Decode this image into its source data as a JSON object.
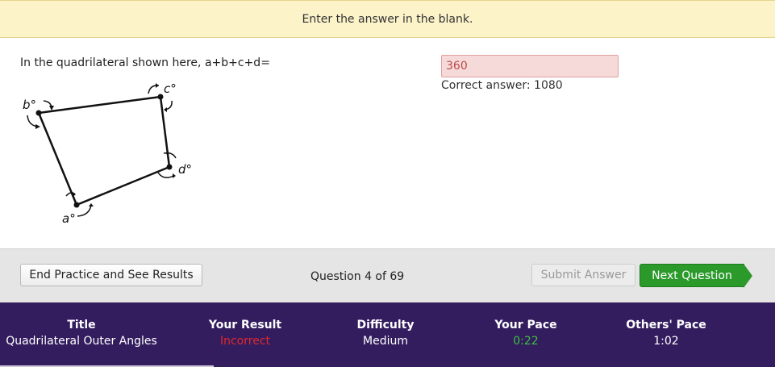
{
  "banner": {
    "text": "Enter the answer in the blank."
  },
  "question": {
    "text": "In the quadrilateral shown here, a+b+c+d=",
    "figure_labels": {
      "a": "a°",
      "b": "b°",
      "c": "c°",
      "d": "d°"
    }
  },
  "answer": {
    "value": "360",
    "correct_label": "Correct answer: 1080"
  },
  "controls": {
    "end_label": "End Practice and See Results",
    "counter": "Question 4 of 69",
    "submit_label": "Submit Answer",
    "next_label": "Next Question"
  },
  "stats": {
    "title_head": "Title",
    "title_val": "Quadrilateral Outer Angles",
    "result_head": "Your Result",
    "result_val": "Incorrect",
    "difficulty_head": "Difficulty",
    "difficulty_val": "Medium",
    "pace_head": "Your Pace",
    "pace_val": "0:22",
    "others_head": "Others' Pace",
    "others_val": "1:02"
  },
  "colors": {
    "banner_bg": "#fcf3c9",
    "incorrect": "#e0282e",
    "pace_good": "#3fbf3f",
    "next_button": "#2b9a2b",
    "stats_bg": "#331d5f"
  }
}
